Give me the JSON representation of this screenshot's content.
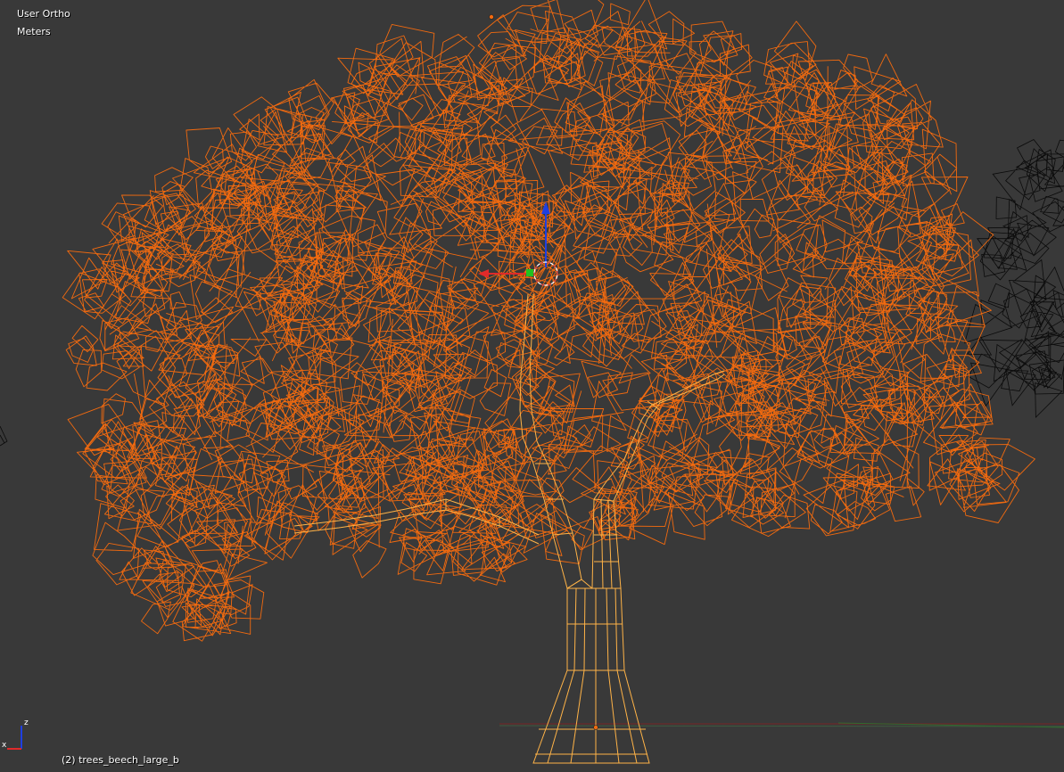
{
  "viewport": {
    "view_name": "User Ortho",
    "units": "Meters",
    "object_name": "(2) trees_beech_large_b"
  },
  "axis_widget": {
    "z_label": "z",
    "x_label": "x"
  },
  "colors": {
    "background": "#393939",
    "selected_wire": "#f26a0f",
    "trunk_wire": "#ffb347",
    "unselected_wire": "#000000",
    "gizmo_x": "#e02a2a",
    "gizmo_y": "#21c21f",
    "gizmo_z": "#1f3fe0",
    "grid_red": "#6b2a2a",
    "grid_green": "#2f5b2f"
  },
  "icons": {
    "cursor": "3d-cursor-icon",
    "origin": "object-origin-icon",
    "gizmo": "transform-manipulator-icon"
  }
}
